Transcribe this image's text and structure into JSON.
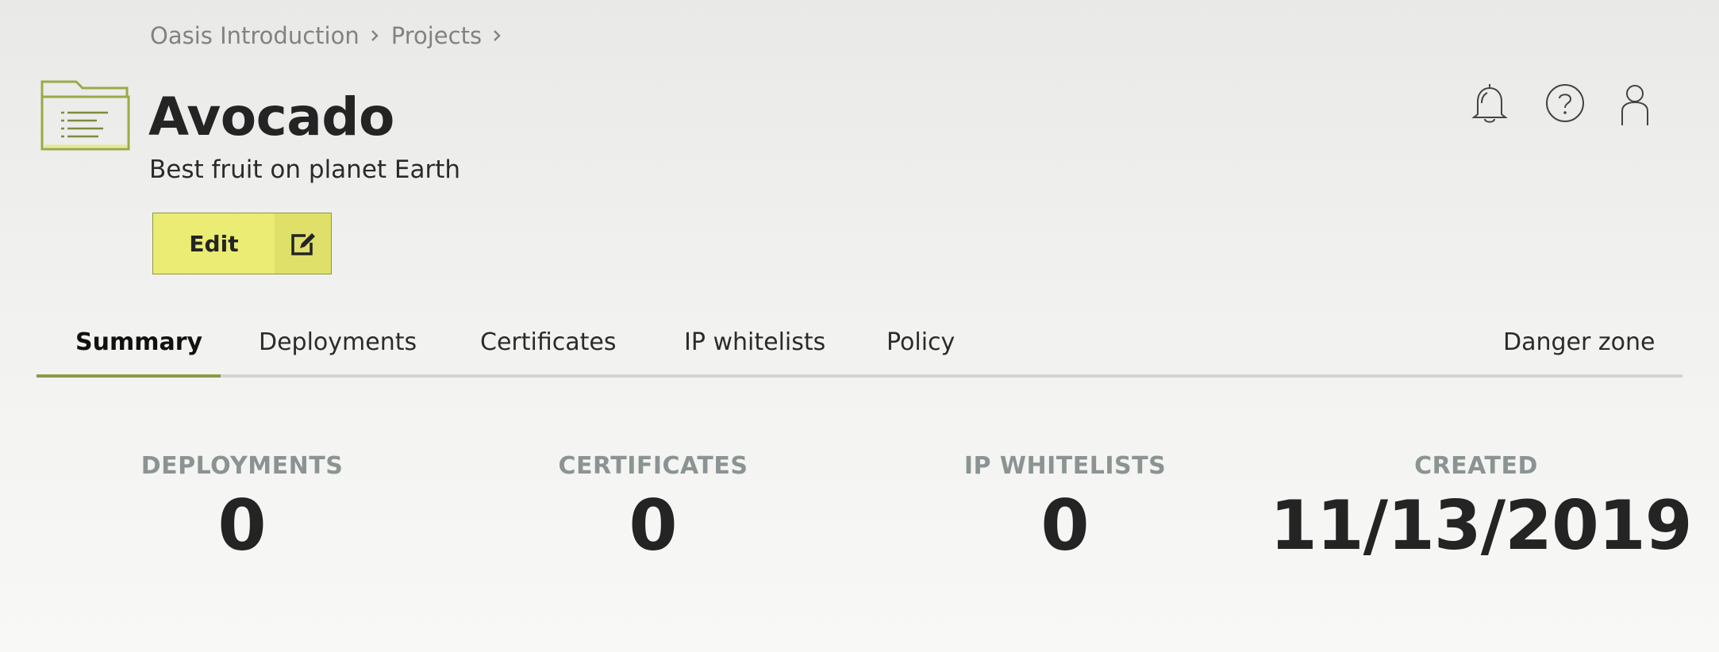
{
  "breadcrumb": {
    "items": [
      "Oasis Introduction",
      "Projects"
    ]
  },
  "project": {
    "title": "Avocado",
    "subtitle": "Best fruit on planet Earth"
  },
  "edit_button": {
    "label": "Edit"
  },
  "header_icons": [
    "bell-icon",
    "help-icon",
    "user-icon"
  ],
  "tabs": [
    {
      "label": "Summary",
      "active": true
    },
    {
      "label": "Deployments"
    },
    {
      "label": "Certificates"
    },
    {
      "label": "IP whitelists"
    },
    {
      "label": "Policy"
    },
    {
      "label": "Danger zone"
    }
  ],
  "stats": [
    {
      "label": "DEPLOYMENTS",
      "value": "0"
    },
    {
      "label": "CERTIFICATES",
      "value": "0"
    },
    {
      "label": "IP WHITELISTS",
      "value": "0"
    },
    {
      "label": "CREATED",
      "value": "11/13/2019"
    }
  ],
  "colors": {
    "accent_green": "#8a9a44",
    "edit_button_bg": "#eaec73",
    "label_gray": "#8b9393",
    "text_dark": "#242424"
  }
}
